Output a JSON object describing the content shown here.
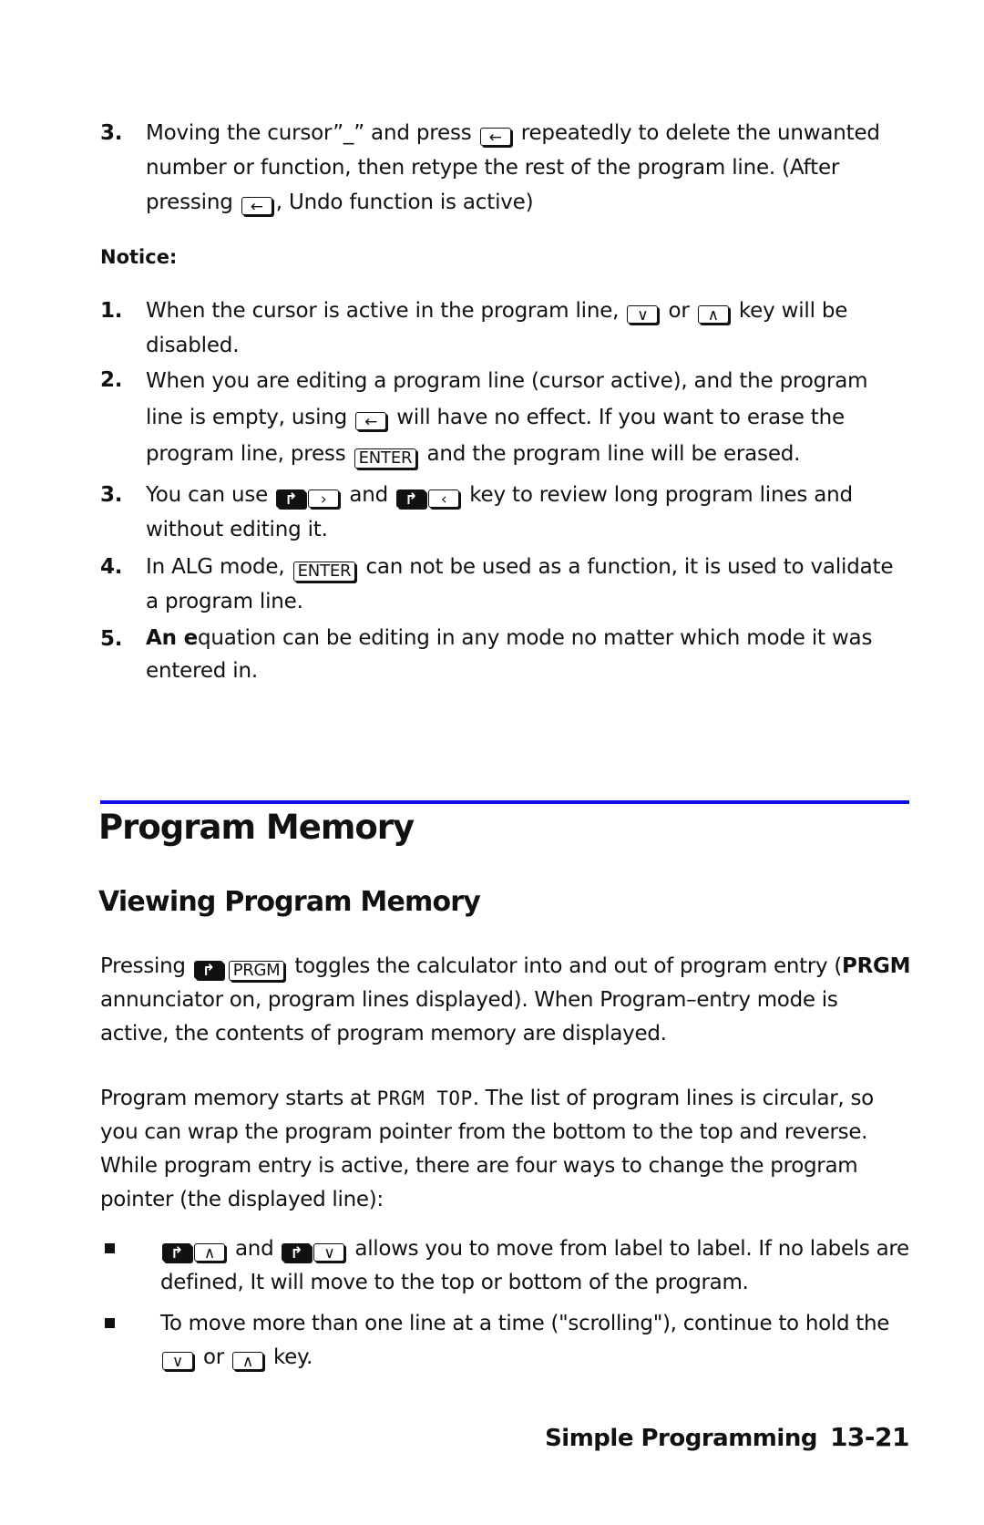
{
  "top_list": [
    {
      "number": "3.",
      "parts": [
        "Moving the cursor”_” and press ",
        " repeatedly to delete the unwanted number or function, then retype the rest of the program line. (After pressing ",
        ", Undo function is active)"
      ]
    }
  ],
  "notice_label": "Notice:",
  "notice_items": [
    {
      "number": "1.",
      "parts": [
        "When the cursor is active in the program line, ",
        " or ",
        " key will be disabled."
      ]
    },
    {
      "number": "2.",
      "parts": [
        "When you are editing a program line (cursor active), and the program line is empty, using ",
        " will have no effect. If you want to erase the program line, press ",
        " and the program line will be erased."
      ]
    },
    {
      "number": "3.",
      "parts": [
        "You can use ",
        " and ",
        " key to review long program lines and without editing it."
      ]
    },
    {
      "number": "4.",
      "parts": [
        "In  ALG mode, ",
        "  can not be used as a function, it is used to validate a program line."
      ]
    },
    {
      "number": "5.",
      "bold_lead": "An e",
      "parts": [
        "quation can be editing in any mode no matter which mode it was entered in."
      ]
    }
  ],
  "keys": {
    "backspace": "←",
    "down": "∨",
    "up": "∧",
    "right": "›",
    "left": "‹",
    "shift_right": "↱",
    "enter": "ENTER",
    "prgm": "PRGM"
  },
  "section": {
    "title": "Program Memory",
    "subtitle": "Viewing Program Memory",
    "rule_color": "#0a10e6"
  },
  "para1": {
    "lead": "Pressing ",
    "mid": " toggles the calculator into and out of program entry (",
    "bold": "PRGM",
    "tail": " annunciator on, program lines displayed). When Program–entry mode is active, the contents of program memory are displayed."
  },
  "para2": {
    "lead": "Program memory starts at ",
    "lcd": "PRGM TOP",
    "tail": ". The list of program lines is circular, so you can wrap the program pointer from the bottom to the top and reverse. While program entry is active, there are four ways to change the program pointer (the displayed line):"
  },
  "bullets": [
    {
      "parts": [
        " and ",
        " allows you to move from label to label. If no labels are defined, It will move to the top or bottom of the program."
      ]
    },
    {
      "parts": [
        "To move more than one line at a time (\"scrolling\"), continue to hold the ",
        " or ",
        " key."
      ]
    }
  ],
  "footer": {
    "chapter": "Simple Programming",
    "page": "13-21"
  }
}
